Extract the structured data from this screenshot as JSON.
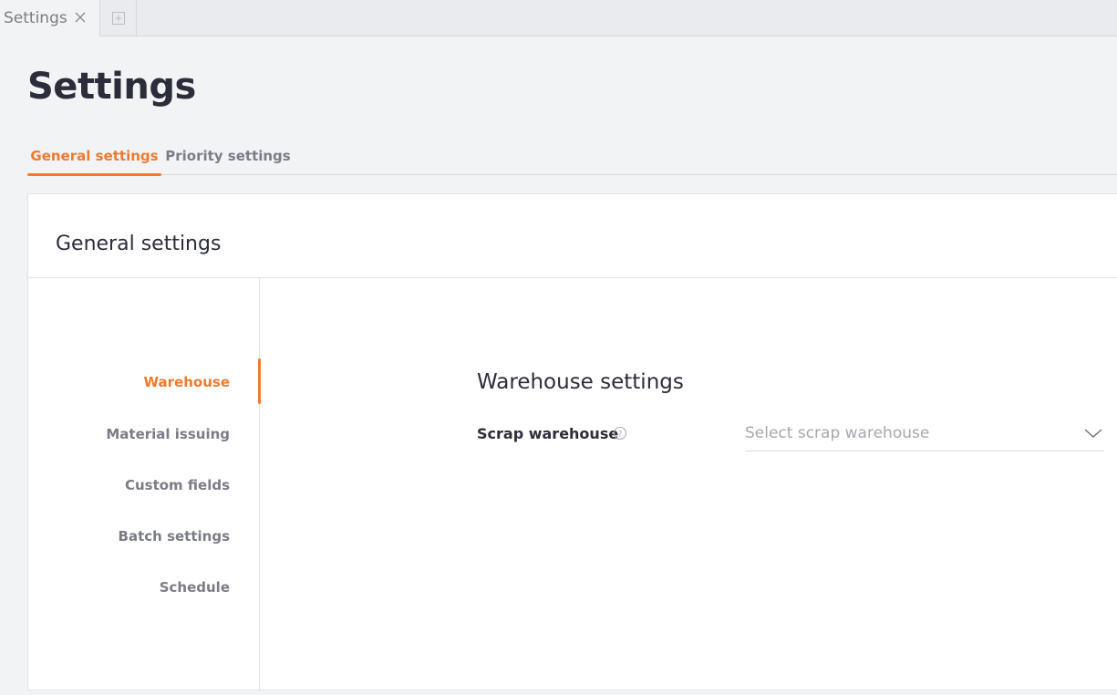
{
  "tabstrip": {
    "tab_label": "Settings",
    "close_icon": "close-icon",
    "new_tab_icon": "add-tab-icon"
  },
  "page": {
    "title": "Settings"
  },
  "top_tabs": [
    {
      "label": "General settings",
      "active": true
    },
    {
      "label": "Priority settings",
      "active": false
    }
  ],
  "card": {
    "title": "General settings"
  },
  "side_nav": {
    "items": [
      {
        "label": "Warehouse",
        "active": true
      },
      {
        "label": "Material issuing",
        "active": false
      },
      {
        "label": "Custom fields",
        "active": false
      },
      {
        "label": "Batch settings",
        "active": false
      },
      {
        "label": "Schedule",
        "active": false
      }
    ]
  },
  "warehouse_section": {
    "title": "Warehouse settings",
    "scrap_label": "Scrap warehouse",
    "help_icon": "help-circle-icon",
    "scrap_placeholder": "Select scrap warehouse",
    "dropdown_icon": "chevron-down-icon"
  },
  "colors": {
    "accent": "#f07a2c",
    "text_primary": "#2b2d3a",
    "text_muted": "#7a7d86",
    "background": "#f2f3f5"
  }
}
